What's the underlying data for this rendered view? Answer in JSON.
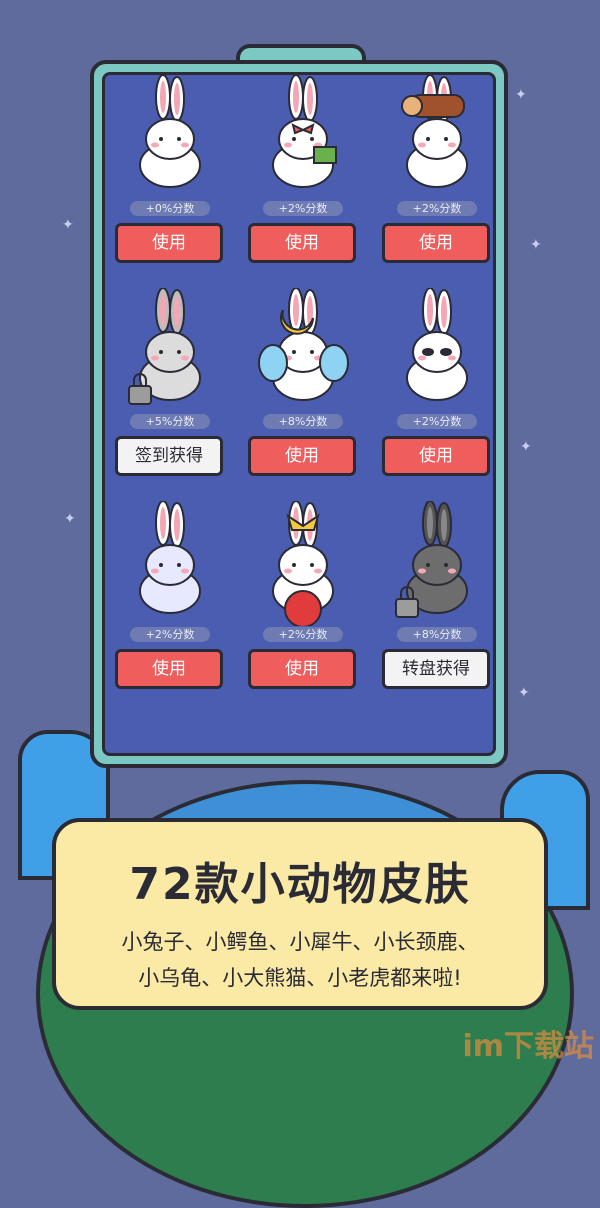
{
  "skins": [
    {
      "bonus": "+0%分数",
      "button": "使用",
      "variant": "plain",
      "locked": false
    },
    {
      "bonus": "+2%分数",
      "button": "使用",
      "variant": "bow-book",
      "locked": false
    },
    {
      "bonus": "+2%分数",
      "button": "使用",
      "variant": "log",
      "locked": false
    },
    {
      "bonus": "+5%分数",
      "button": "签到获得",
      "variant": "gray",
      "locked": true
    },
    {
      "bonus": "+8%分数",
      "button": "使用",
      "variant": "moon-fairy",
      "locked": false
    },
    {
      "bonus": "+2%分数",
      "button": "使用",
      "variant": "panda",
      "locked": false
    },
    {
      "bonus": "+2%分数",
      "button": "使用",
      "variant": "ghost",
      "locked": false
    },
    {
      "bonus": "+2%分数",
      "button": "使用",
      "variant": "jester-ball",
      "locked": false
    },
    {
      "bonus": "+8%分数",
      "button": "转盘获得",
      "variant": "shadow",
      "locked": true
    }
  ],
  "promo": {
    "title": "72款小动物皮肤",
    "line1": "小兔子、小鳄鱼、小犀牛、小长颈鹿、",
    "line2": "小乌龟、小大熊猫、小老虎都来啦!"
  },
  "watermark": "im下载站",
  "colors": {
    "use_button": "#ef5d5d",
    "screen": "#4a5db0",
    "tablet": "#7cc8c3",
    "banner": "#fbeaa6"
  }
}
